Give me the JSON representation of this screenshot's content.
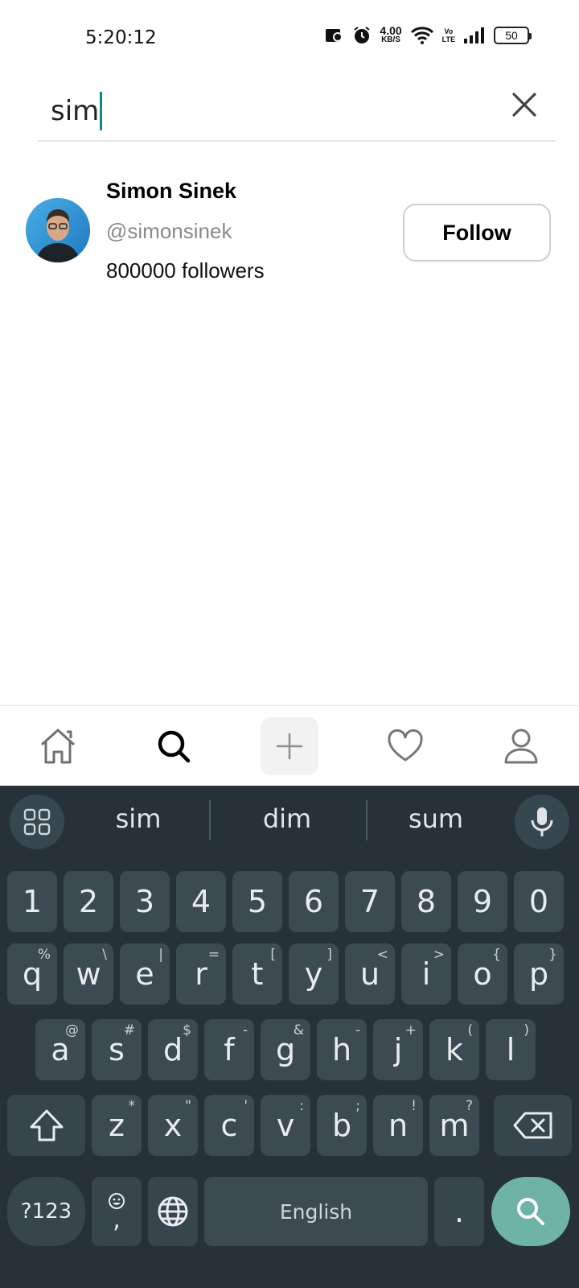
{
  "status_bar": {
    "time": "5:20:12",
    "net_speed_value": "4.00",
    "net_speed_unit": "KB/S",
    "volte_top": "Vo",
    "volte_bottom": "LTE",
    "battery": "50"
  },
  "search": {
    "query": "sim"
  },
  "result": {
    "name": "Simon Sinek",
    "handle": "@simonsinek",
    "followers": "800000 followers",
    "follow_label": "Follow"
  },
  "bottom_nav": {
    "items": [
      {
        "icon": "home-icon"
      },
      {
        "icon": "search-icon",
        "active": true
      },
      {
        "icon": "plus-icon"
      },
      {
        "icon": "heart-icon"
      },
      {
        "icon": "profile-icon"
      }
    ]
  },
  "keyboard": {
    "suggestions": [
      "sim",
      "dim",
      "sum"
    ],
    "numbers": [
      "1",
      "2",
      "3",
      "4",
      "5",
      "6",
      "7",
      "8",
      "9",
      "0"
    ],
    "row1": [
      {
        "k": "q",
        "s": "%"
      },
      {
        "k": "w",
        "s": "\\"
      },
      {
        "k": "e",
        "s": "|"
      },
      {
        "k": "r",
        "s": "="
      },
      {
        "k": "t",
        "s": "["
      },
      {
        "k": "y",
        "s": "]"
      },
      {
        "k": "u",
        "s": "<"
      },
      {
        "k": "i",
        "s": ">"
      },
      {
        "k": "o",
        "s": "{"
      },
      {
        "k": "p",
        "s": "}"
      }
    ],
    "row2": [
      {
        "k": "a",
        "s": "@"
      },
      {
        "k": "s",
        "s": "#"
      },
      {
        "k": "d",
        "s": "$"
      },
      {
        "k": "f",
        "s": "-"
      },
      {
        "k": "g",
        "s": "&"
      },
      {
        "k": "h",
        "s": "-"
      },
      {
        "k": "j",
        "s": "+"
      },
      {
        "k": "k",
        "s": "("
      },
      {
        "k": "l",
        "s": ")"
      }
    ],
    "row3": [
      {
        "k": "z",
        "s": "*"
      },
      {
        "k": "x",
        "s": "\""
      },
      {
        "k": "c",
        "s": "'"
      },
      {
        "k": "v",
        "s": ":"
      },
      {
        "k": "b",
        "s": ";"
      },
      {
        "k": "n",
        "s": "!"
      },
      {
        "k": "m",
        "s": "?"
      }
    ],
    "symbols_label": "?123",
    "emoji_comma": ",",
    "space_label": "English",
    "period": ".",
    "enter_accent": "#6fb3a7"
  },
  "colors": {
    "caret": "#0b8f80",
    "keyboard_bg": "#263238",
    "key_bg": "#3c4a51"
  }
}
